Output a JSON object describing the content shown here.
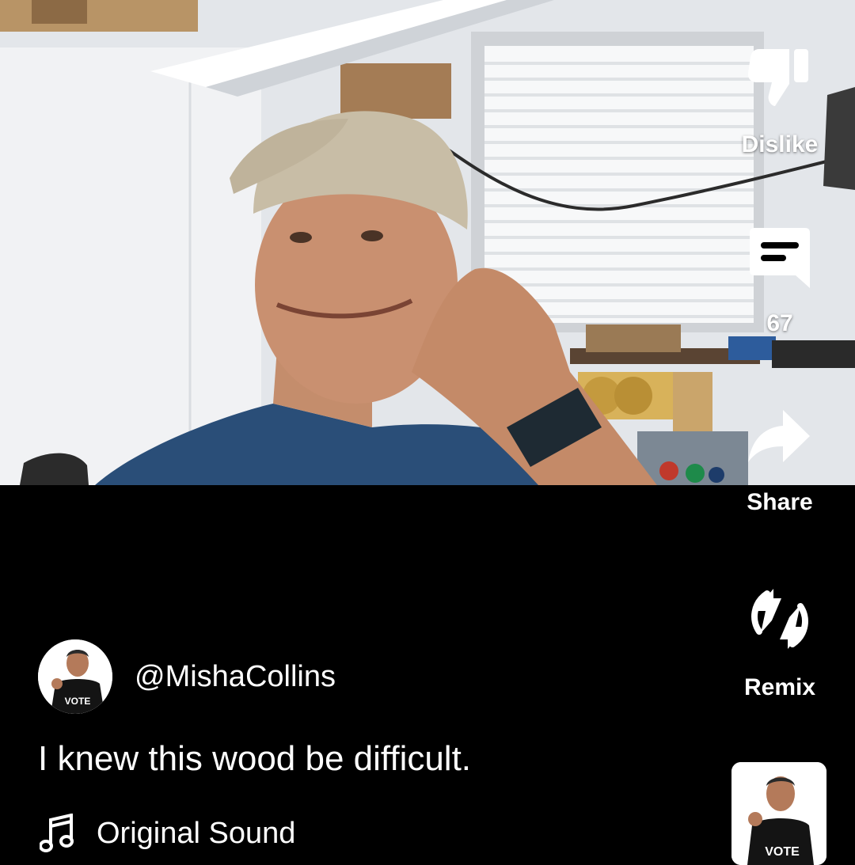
{
  "actions": {
    "dislike": {
      "label": "Dislike",
      "icon": "dislike-icon"
    },
    "comments": {
      "count": "67",
      "icon": "comment-icon"
    },
    "share": {
      "label": "Share",
      "icon": "share-icon"
    },
    "remix": {
      "label": "Remix",
      "icon": "remix-icon"
    }
  },
  "channel": {
    "handle": "@MishaCollins",
    "avatar_shirt_text": "VOTE"
  },
  "caption": "I knew this wood be difficult.",
  "sound": {
    "name": "Original Sound",
    "icon": "music-note-icon",
    "thumb_shirt_text": "VOTE"
  },
  "colors": {
    "background": "#000000",
    "text": "#ffffff"
  }
}
